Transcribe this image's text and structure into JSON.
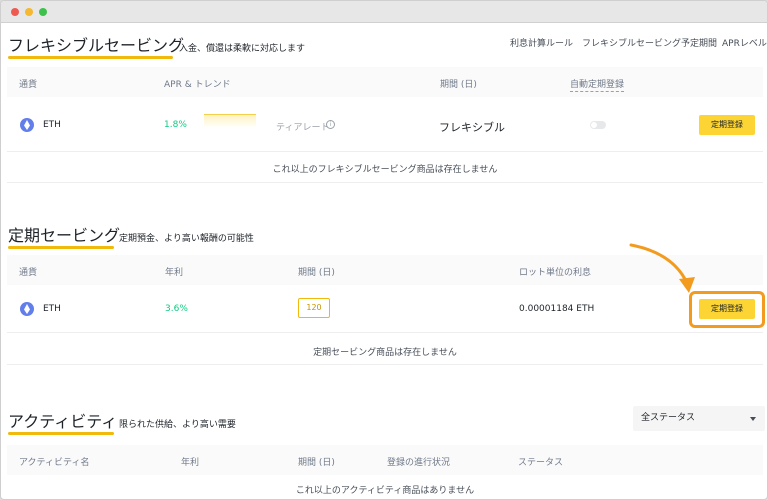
{
  "flexible": {
    "title": "フレキシブルセービング",
    "subtitle": "入金、償還は柔軟に対応します",
    "links": [
      "利息計算ルール",
      "フレキシブルセービング予定期間",
      "APRレベル"
    ],
    "columns": [
      "通貨",
      "APR & トレンド",
      "期間 (日)",
      "自動定期登録"
    ],
    "row": {
      "coin": "ETH",
      "apr": "1.8%",
      "tier": "ティアレート",
      "info_icon": "info-icon",
      "period": "フレキシブル",
      "button": "定期登録"
    },
    "empty": "これ以上のフレキシブルセービング商品は存在しません"
  },
  "fixed": {
    "title": "定期セービング",
    "subtitle": "定期預金、より高い報酬の可能性",
    "columns": [
      "通貨",
      "年利",
      "期間 (日)",
      "ロット単位の利息"
    ],
    "row": {
      "coin": "ETH",
      "apr": "3.6%",
      "period": "120",
      "lot_interest": "0.00001184 ETH",
      "button": "定期登録"
    },
    "empty": "定期セービング商品は存在しません"
  },
  "activity": {
    "title": "アクティビティ",
    "subtitle": "限られた供給、より高い需要",
    "status_select": "全ステータス",
    "columns": [
      "アクティビティ名",
      "年利",
      "期間 (日)",
      "登録の進行状況",
      "ステータス"
    ],
    "empty": "これ以上のアクティビティ商品はありません"
  },
  "colors": {
    "accent": "#f0b90b",
    "button": "#fcd535",
    "positive": "#0ecb81",
    "highlight": "#f29b1e",
    "eth": "#627eea"
  }
}
